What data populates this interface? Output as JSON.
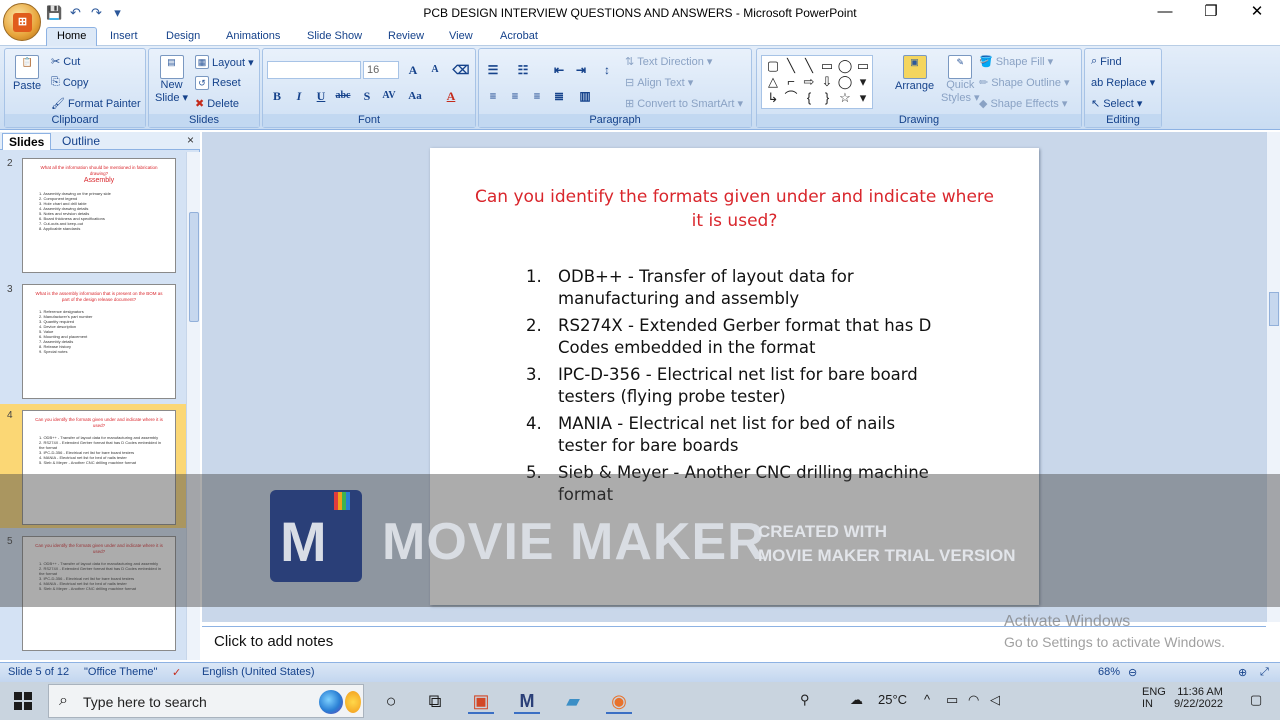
{
  "window": {
    "title": "PCB DESIGN INTERVIEW QUESTIONS AND ANSWERS - Microsoft PowerPoint",
    "minimize": "—",
    "maximize": "❐",
    "close": "✕"
  },
  "qat": {
    "save": "💾",
    "undo": "↶",
    "redo": "↷",
    "more": "▾"
  },
  "tabs": [
    "Home",
    "Insert",
    "Design",
    "Animations",
    "Slide Show",
    "Review",
    "View",
    "Acrobat"
  ],
  "ribbon": {
    "clipboard": {
      "label": "Clipboard",
      "paste": "Paste",
      "cut": "Cut",
      "copy": "Copy",
      "format_painter": "Format Painter"
    },
    "slides": {
      "label": "Slides",
      "new_slide": "New",
      "new_slide2": "Slide ▾",
      "layout": "Layout ▾",
      "reset": "Reset",
      "delete": "Delete"
    },
    "font": {
      "label": "Font",
      "font_name": "",
      "font_size": "16",
      "grow": "A",
      "shrink": "A",
      "bold": "B",
      "italic": "I",
      "underline": "U",
      "strike": "abc",
      "shadow": "S",
      "spacing": "AV",
      "case": "Aa",
      "color": "A"
    },
    "paragraph": {
      "label": "Paragraph",
      "text_direction": "Text Direction ▾",
      "align_text": "Align Text ▾",
      "smartart": "Convert to SmartArt ▾"
    },
    "drawing": {
      "label": "Drawing",
      "arrange": "Arrange",
      "quick_styles": "Quick",
      "quick_styles2": "Styles ▾",
      "shape_fill": "Shape Fill ▾",
      "shape_outline": "Shape Outline ▾",
      "shape_effects": "Shape Effects ▾",
      "shapes": [
        "▢",
        "╲",
        "╲",
        "▭",
        "◯",
        "▭",
        "△",
        "⌐",
        "⇨",
        "⇩",
        "◯",
        "▾",
        "↳",
        "⌒",
        "{",
        "}",
        "☆",
        "▾"
      ]
    },
    "editing": {
      "label": "Editing",
      "find": "Find",
      "replace": "Replace ▾",
      "select": "Select ▾"
    }
  },
  "panel": {
    "tab_slides": "Slides",
    "tab_outline": "Outline",
    "close": "×",
    "thumbs": [
      {
        "num": "2",
        "title": "What all the information should be mentioned in fabrication drawing?",
        "heading": "Assembly",
        "lines": [
          "1. Assembly drawing on the primary side",
          "2. Component legend",
          "3. Hole chart and drill table",
          "4. Assembly drawing details",
          "5. Notes and revision details",
          "6. Board thickness and specifications",
          "7. Cut-outs and keep-out",
          "8. Applicable standards"
        ]
      },
      {
        "num": "3",
        "title": "What is the assembly information that is present on the BOM as part of the design release document?",
        "heading": "",
        "lines": [
          "1. Reference designators",
          "2. Manufacturer's part number",
          "3. Quantity required",
          "4. Device description",
          "5. Value",
          "6. Mounting and placement",
          "7. Assembly details",
          "8. Release history",
          "9. Special notes"
        ]
      },
      {
        "num": "4",
        "title": "Can you identify the formats given under and indicate where it is used?",
        "heading": "",
        "lines": [
          "1. ODB++ - Transfer of layout data for manufacturing and assembly",
          "2. RS274X - Extended Gerber format that has D Codes embedded in the format",
          "3. IPC-D-356 - Electrical net list for bare board testers",
          "4. MANIA - Electrical net list for bed of nails tester",
          "5. Sieb & Meyer - Another CNC drilling machine format"
        ]
      },
      {
        "num": "5",
        "title": "Can you identify the formats given under and indicate where it is used?",
        "heading": "",
        "lines": [
          "1. ODB++ - Transfer of layout data for manufacturing and assembly",
          "2. RS274X - Extended Gerber format that has D Codes embedded in the format",
          "3. IPC-D-356 - Electrical net list for bare board testers",
          "4. MANIA - Electrical net list for bed of nails tester",
          "5. Sieb & Meyer - Another CNC drilling machine format"
        ]
      }
    ]
  },
  "slide": {
    "title": "Can you identify the formats given under and indicate where it is used?",
    "items": [
      {
        "n": "1.",
        "text": "ODB++ - Transfer of layout data for manufacturing and assembly"
      },
      {
        "n": "2.",
        "text": "RS274X - Extended Gerber format that has D Codes embedded in the format"
      },
      {
        "n": "3.",
        "text": "IPC-D-356 - Electrical net list for bare board testers (flying probe tester)"
      },
      {
        "n": "4.",
        "text": "MANIA - Electrical net list for bed of nails tester for bare boards"
      },
      {
        "n": "5.",
        "text": "Sieb & Meyer - Another CNC drilling machine format"
      }
    ]
  },
  "notes": {
    "placeholder": "Click to add notes"
  },
  "watermark": {
    "brand": "MOVIE MAKER",
    "line1": "CREATED WITH",
    "line2": "MOVIE MAKER TRIAL VERSION"
  },
  "activate": {
    "line1": "Activate Windows",
    "line2": "Go to Settings to activate Windows."
  },
  "status": {
    "slide_of": "Slide 5 of 12",
    "theme": "\"Office Theme\"",
    "language": "English (United States)",
    "zoom": "68%"
  },
  "taskbar": {
    "search_placeholder": "Type here to search",
    "temperature": "25°C",
    "lang": "ENG",
    "lang2": "IN",
    "time": "11:36 AM",
    "date": "9/22/2022"
  },
  "colors": {
    "title_red": "#d9262c",
    "ribbon_blue": "#15428b",
    "selected_thumb": "#fbd775"
  }
}
